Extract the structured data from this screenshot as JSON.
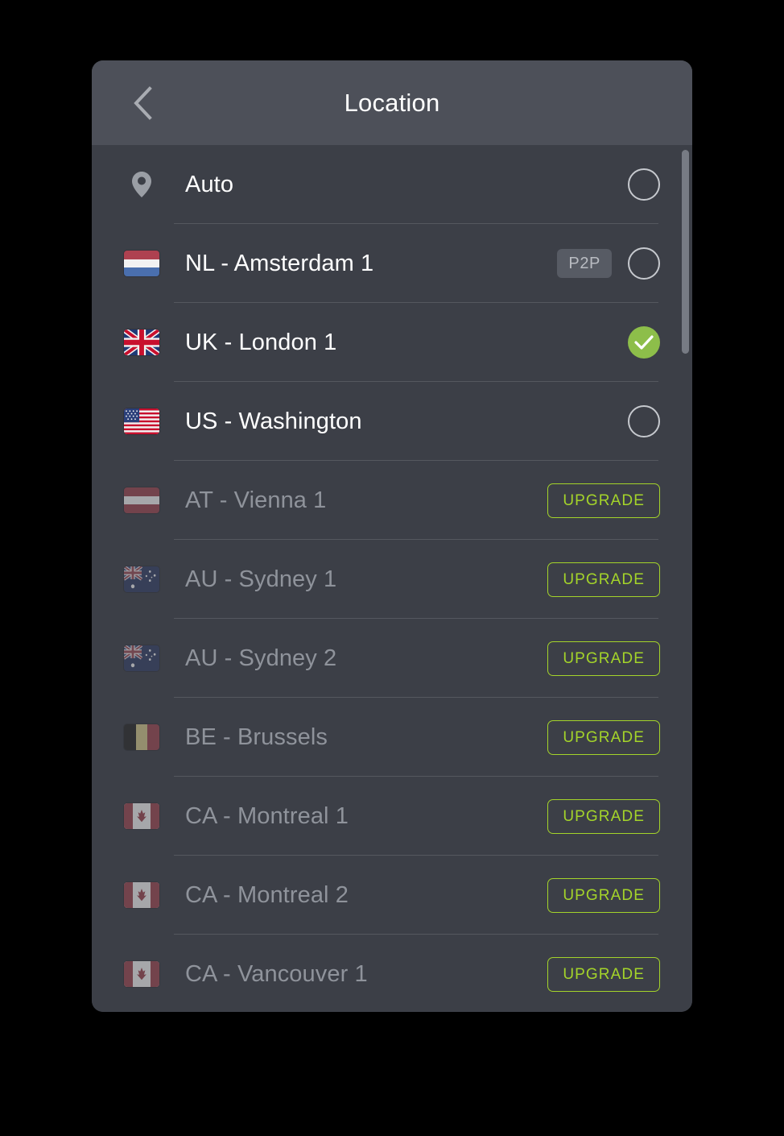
{
  "header": {
    "title": "Location",
    "back_icon": "chevron-left-icon"
  },
  "scrollbar": {
    "orientation": "vertical"
  },
  "labels": {
    "upgrade": "UPGRADE",
    "p2p": "P2P"
  },
  "rows": [
    {
      "label": "Auto",
      "icon": "location-pin-icon",
      "flag": null,
      "state": "available",
      "selected": false,
      "badge": null,
      "action": "radio"
    },
    {
      "label": "NL - Amsterdam 1",
      "icon": null,
      "flag": "netherlands-flag",
      "state": "available",
      "selected": false,
      "badge": "P2P",
      "action": "radio"
    },
    {
      "label": "UK - London 1",
      "icon": null,
      "flag": "united-kingdom-flag",
      "state": "available",
      "selected": true,
      "badge": null,
      "action": "radio"
    },
    {
      "label": "US - Washington",
      "icon": null,
      "flag": "united-states-flag",
      "state": "available",
      "selected": false,
      "badge": null,
      "action": "radio"
    },
    {
      "label": "AT - Vienna 1",
      "icon": null,
      "flag": "austria-flag",
      "state": "locked",
      "selected": false,
      "badge": null,
      "action": "upgrade"
    },
    {
      "label": "AU - Sydney 1",
      "icon": null,
      "flag": "australia-flag",
      "state": "locked",
      "selected": false,
      "badge": null,
      "action": "upgrade"
    },
    {
      "label": "AU - Sydney 2",
      "icon": null,
      "flag": "australia-flag",
      "state": "locked",
      "selected": false,
      "badge": null,
      "action": "upgrade"
    },
    {
      "label": "BE - Brussels",
      "icon": null,
      "flag": "belgium-flag",
      "state": "locked",
      "selected": false,
      "badge": null,
      "action": "upgrade"
    },
    {
      "label": "CA - Montreal 1",
      "icon": null,
      "flag": "canada-flag",
      "state": "locked",
      "selected": false,
      "badge": null,
      "action": "upgrade"
    },
    {
      "label": "CA - Montreal 2",
      "icon": null,
      "flag": "canada-flag",
      "state": "locked",
      "selected": false,
      "badge": null,
      "action": "upgrade"
    },
    {
      "label": "CA - Vancouver 1",
      "icon": null,
      "flag": "canada-flag",
      "state": "locked",
      "selected": false,
      "badge": null,
      "action": "upgrade"
    }
  ],
  "colors": {
    "panel_bg": "#3c3f47",
    "header_bg": "#4d5059",
    "accent_green": "#8dbe4a",
    "upgrade_green": "#a4d42a",
    "text_primary": "#ffffff",
    "text_muted": "#8f939b",
    "divider": "#55585f",
    "badge_bg": "#575b64",
    "scrollbar_thumb": "#777b84"
  }
}
